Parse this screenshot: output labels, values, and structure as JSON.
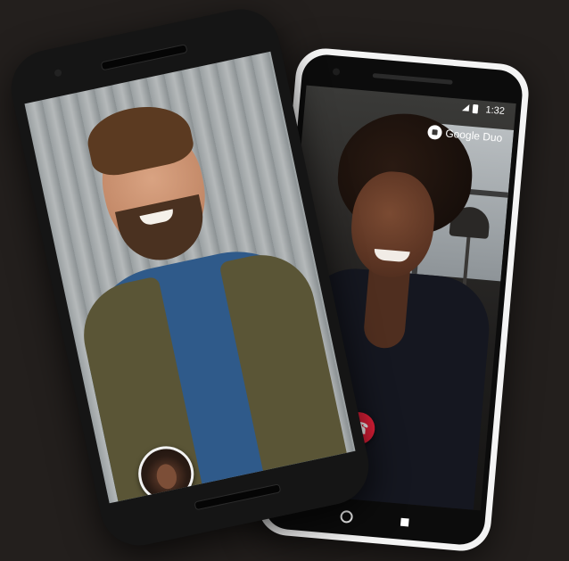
{
  "right_phone": {
    "status_time": "1:32",
    "brand_name": "Google Duo",
    "end_call_icon": "end-call-phone-icon",
    "nav": {
      "home_icon": "home-circle-icon",
      "recents_icon": "recents-square-icon"
    }
  },
  "left_phone": {
    "pip_icon": "self-view-thumbnail"
  },
  "colors": {
    "background": "#231f1d",
    "end_call": "#e8203a",
    "right_frame": "#f4f4f4",
    "left_frame": "#151515"
  }
}
